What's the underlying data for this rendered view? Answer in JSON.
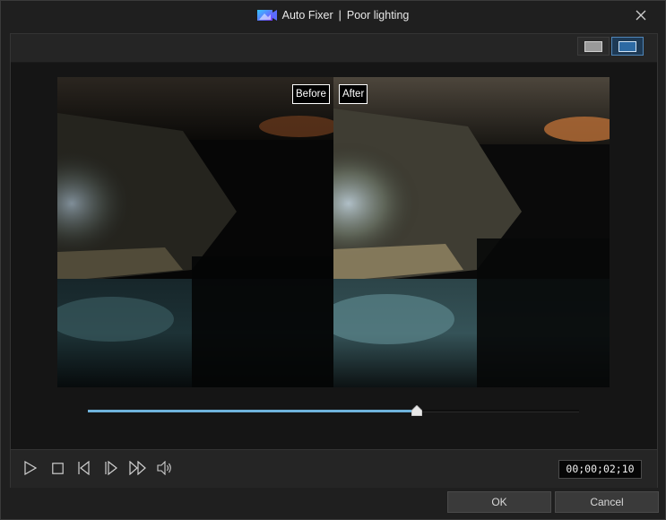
{
  "window": {
    "title": "Auto Fixer",
    "separator": "|",
    "subtitle": "Poor lighting",
    "logo_icon": "app-logo-icon",
    "close_icon": "close-icon"
  },
  "view_modes": [
    {
      "name": "single-view",
      "icon": "single-view-icon",
      "selected": false
    },
    {
      "name": "split-view",
      "icon": "split-view-icon",
      "selected": true
    }
  ],
  "preview": {
    "before_label": "Before",
    "after_label": "After"
  },
  "playback": {
    "progress": 0.67,
    "timecode": "00;00;02;10",
    "accent_color": "#6fb3dc",
    "controls": [
      "play-icon",
      "stop-icon",
      "previous-frame-icon",
      "next-frame-icon",
      "fast-forward-icon",
      "volume-icon"
    ]
  },
  "buttons": {
    "ok_label": "OK",
    "cancel_label": "Cancel"
  }
}
